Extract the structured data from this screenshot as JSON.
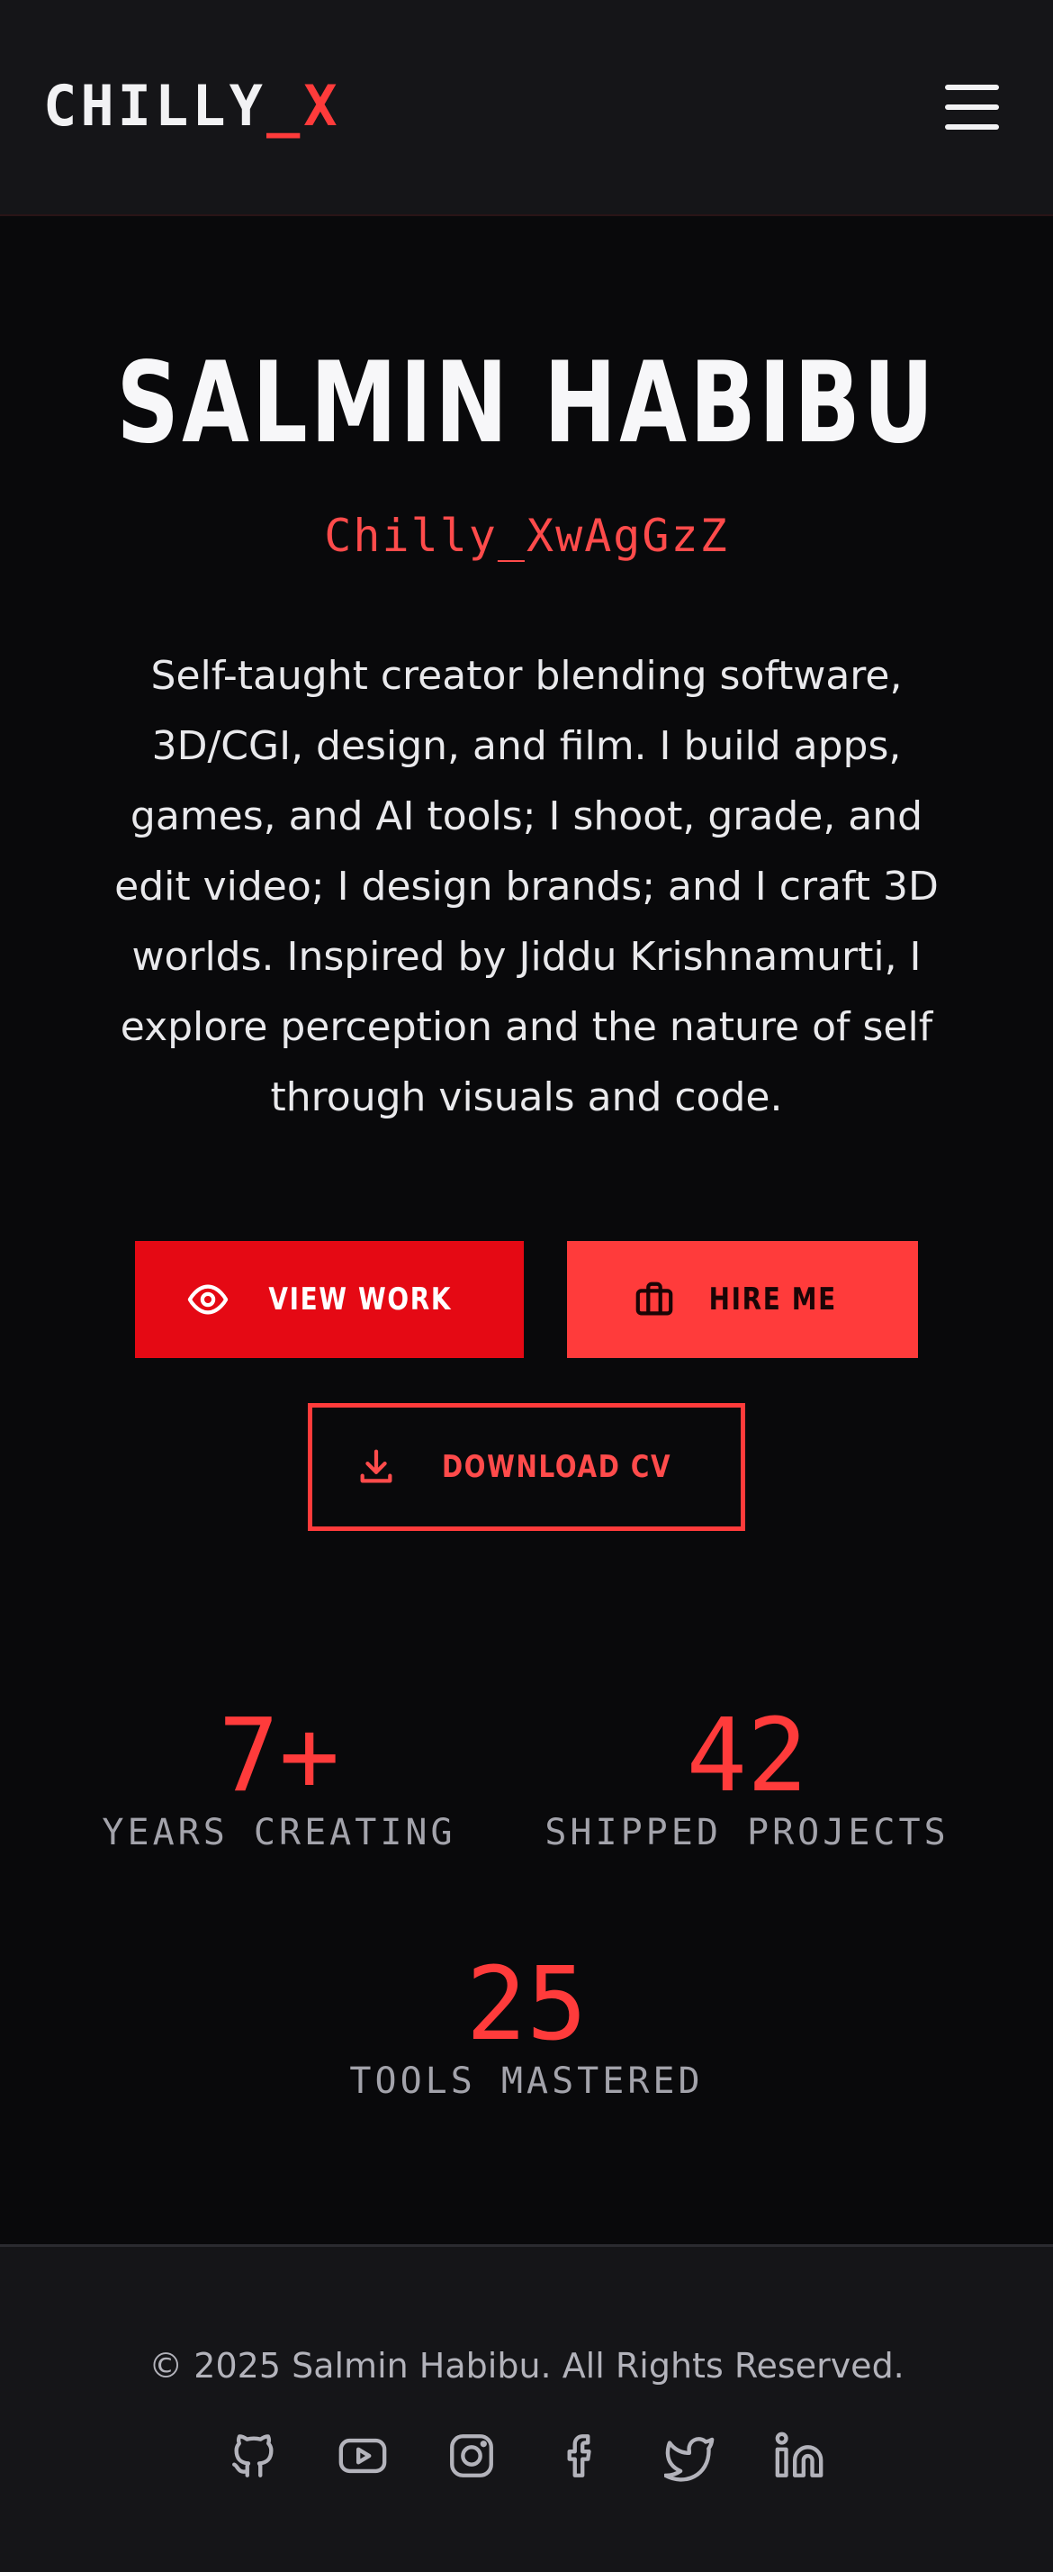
{
  "header": {
    "logo_main": "CHILLY",
    "logo_accent": "_X",
    "menu_icon": "hamburger-menu-icon"
  },
  "hero": {
    "name": "SALMIN HABIBU",
    "handle": "Chilly_XwAgGzZ",
    "bio": "Self-taught creator blending software, 3D/CGI, design, and film. I build apps, games, and AI tools; I shoot, grade, and edit video; I design brands; and I craft 3D worlds. Inspired by Jiddu Krishnamurti, I explore perception and the nature of self through visuals and code."
  },
  "buttons": {
    "view_work": {
      "label": "VIEW WORK",
      "icon": "eye-icon"
    },
    "hire_me": {
      "label": "HIRE ME",
      "icon": "briefcase-icon"
    },
    "download_cv": {
      "label": "DOWNLOAD CV",
      "icon": "download-icon"
    }
  },
  "stats": [
    {
      "value": "7+",
      "label": "YEARS CREATING"
    },
    {
      "value": "42",
      "label": "SHIPPED PROJECTS"
    },
    {
      "value": "25",
      "label": "TOOLS MASTERED"
    }
  ],
  "footer": {
    "copyright": "© 2025 Salmin Habibu. All Rights Reserved.",
    "socials": [
      "github-icon",
      "youtube-icon",
      "instagram-icon",
      "facebook-icon",
      "twitter-icon",
      "linkedin-icon"
    ]
  },
  "colors": {
    "accent": "#ff3b3b",
    "primary_button": "#e50914",
    "background": "#09090b",
    "surface": "#151518"
  }
}
